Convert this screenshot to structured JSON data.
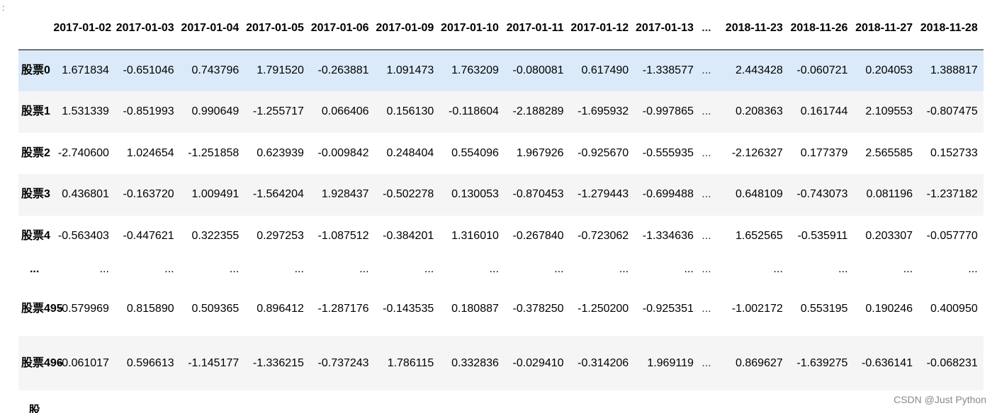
{
  "page": {
    "corner_mark": ":",
    "watermark": "CSDN @Just Python"
  },
  "columns": [
    "",
    "2017-01-02",
    "2017-01-03",
    "2017-01-04",
    "2017-01-05",
    "2017-01-06",
    "2017-01-09",
    "2017-01-10",
    "2017-01-11",
    "2017-01-12",
    "2017-01-13",
    "...",
    "2018-11-23",
    "2018-11-26",
    "2018-11-27",
    "2018-11-28",
    ""
  ],
  "rows": [
    {
      "index": "股票0",
      "values": [
        "1.671834",
        "-0.651046",
        "0.743796",
        "1.791520",
        "-0.263881",
        "1.091473",
        "1.763209",
        "-0.080081",
        "0.617490",
        "-1.338577",
        "...",
        "2.443428",
        "-0.060721",
        "0.204053",
        "1.388817",
        "-"
      ]
    },
    {
      "index": "股票1",
      "values": [
        "1.531339",
        "-0.851993",
        "0.990649",
        "-1.255717",
        "0.066406",
        "0.156130",
        "-0.118604",
        "-2.188289",
        "-1.695932",
        "-0.997865",
        "...",
        "0.208363",
        "0.161744",
        "2.109553",
        "-0.807475",
        "-("
      ]
    },
    {
      "index": "股票2",
      "values": [
        "-2.740600",
        "1.024654",
        "-1.251858",
        "0.623939",
        "-0.009842",
        "0.248404",
        "0.554096",
        "1.967926",
        "-0.925670",
        "-0.555935",
        "...",
        "-2.126327",
        "0.177379",
        "2.565585",
        "0.152733",
        "("
      ]
    },
    {
      "index": "股票3",
      "values": [
        "0.436801",
        "-0.163720",
        "1.009491",
        "-1.564204",
        "1.928437",
        "-0.502278",
        "0.130053",
        "-0.870453",
        "-1.279443",
        "-0.699488",
        "...",
        "0.648109",
        "-0.743073",
        "0.081196",
        "-1.237182",
        "-("
      ]
    },
    {
      "index": "股票4",
      "values": [
        "-0.563403",
        "-0.447621",
        "0.322355",
        "0.297253",
        "-1.087512",
        "-0.384201",
        "1.316010",
        "-0.267840",
        "-0.723062",
        "-1.334636",
        "...",
        "1.652565",
        "-0.535911",
        "0.203307",
        "-0.057770",
        "("
      ]
    },
    {
      "index": "...",
      "values": [
        "...",
        "...",
        "...",
        "...",
        "...",
        "...",
        "...",
        "...",
        "...",
        "...",
        "...",
        "...",
        "...",
        "...",
        "...",
        ""
      ]
    },
    {
      "index": "股票495",
      "values": [
        "-0.579969",
        "0.815890",
        "0.509365",
        "0.896412",
        "-1.287176",
        "-0.143535",
        "0.180887",
        "-0.378250",
        "-1.250200",
        "-0.925351",
        "...",
        "-1.002172",
        "0.553195",
        "0.190246",
        "0.400950",
        "("
      ]
    },
    {
      "index": "股票496",
      "values": [
        "-0.061017",
        "0.596613",
        "-1.145177",
        "-1.336215",
        "-0.737243",
        "1.786115",
        "0.332836",
        "-0.029410",
        "-0.314206",
        "1.969119",
        "...",
        "0.869627",
        "-1.639275",
        "-0.636141",
        "-0.068231",
        "-("
      ]
    },
    {
      "index": "股",
      "values": [
        "",
        "",
        "",
        "",
        "",
        "",
        "",
        "",
        "",
        "",
        "",
        "",
        "",
        "",
        "",
        ""
      ]
    }
  ]
}
